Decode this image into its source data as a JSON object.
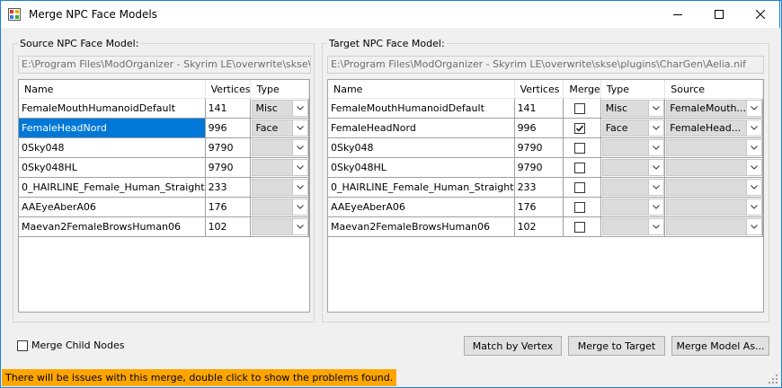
{
  "window": {
    "title": "Merge NPC Face Models"
  },
  "source": {
    "group_label": "Source NPC Face Model:",
    "path": "E:\\Program Files\\ModOrganizer - Skyrim LE\\overwrite\\skse\\plugins\\",
    "columns": {
      "name": "Name",
      "vertices": "Vertices",
      "type": "Type"
    },
    "rows": [
      {
        "name": "FemaleMouthHumanoidDefault",
        "vertices": "141",
        "type": "Misc",
        "selected": false
      },
      {
        "name": "FemaleHeadNord",
        "vertices": "996",
        "type": "Face",
        "selected": true
      },
      {
        "name": "0Sky048",
        "vertices": "9790",
        "type": "",
        "selected": false
      },
      {
        "name": "0Sky048HL",
        "vertices": "9790",
        "type": "",
        "selected": false
      },
      {
        "name": "0_HAIRLINE_Female_Human_Straight",
        "vertices": "233",
        "type": "",
        "selected": false
      },
      {
        "name": "AAEyeAberA06",
        "vertices": "176",
        "type": "",
        "selected": false
      },
      {
        "name": "Maevan2FemaleBrowsHuman06",
        "vertices": "102",
        "type": "",
        "selected": false
      }
    ]
  },
  "target": {
    "group_label": "Target NPC Face Model:",
    "path": "E:\\Program Files\\ModOrganizer - Skyrim LE\\overwrite\\skse\\plugins\\CharGen\\Aelia.nif",
    "columns": {
      "name": "Name",
      "vertices": "Vertices",
      "merge": "Merge",
      "type": "Type",
      "source": "Source"
    },
    "rows": [
      {
        "name": "FemaleMouthHumanoidDefault",
        "vertices": "141",
        "merge": false,
        "type": "Misc",
        "source": "FemaleMouth..."
      },
      {
        "name": "FemaleHeadNord",
        "vertices": "996",
        "merge": true,
        "type": "Face",
        "source": "FemaleHead..."
      },
      {
        "name": "0Sky048",
        "vertices": "9790",
        "merge": false,
        "type": "",
        "source": ""
      },
      {
        "name": "0Sky048HL",
        "vertices": "9790",
        "merge": false,
        "type": "",
        "source": ""
      },
      {
        "name": "0_HAIRLINE_Female_Human_Straight",
        "vertices": "233",
        "merge": false,
        "type": "",
        "source": ""
      },
      {
        "name": "AAEyeAberA06",
        "vertices": "176",
        "merge": false,
        "type": "",
        "source": ""
      },
      {
        "name": "Maevan2FemaleBrowsHuman06",
        "vertices": "102",
        "merge": false,
        "type": "",
        "source": ""
      }
    ]
  },
  "footer": {
    "merge_child_nodes": "Merge Child Nodes",
    "match_by_vertex": "Match by Vertex",
    "merge_to_target": "Merge to Target",
    "merge_model_as": "Merge Model As..."
  },
  "status": {
    "warning": "There will be issues with this merge, double click to show the problems found."
  },
  "colors": {
    "selection": "#0078d7",
    "warning": "#ffa500",
    "window_border": "#1883d7"
  }
}
